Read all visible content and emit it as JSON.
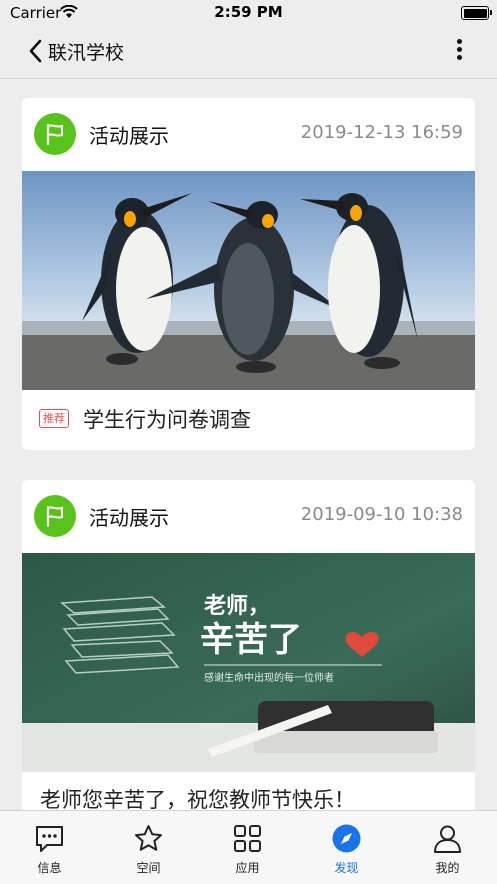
{
  "status_bar": {
    "carrier": "Carrier",
    "time": "2:59 PM"
  },
  "header": {
    "title": "联汛学校"
  },
  "cards": [
    {
      "category": "活动展示",
      "datetime": "2019-12-13 16:59",
      "tag": "推荐",
      "title": "学生行为问卷调查"
    },
    {
      "category": "活动展示",
      "datetime": "2019-09-10 10:38",
      "title": "老师您辛苦了，祝您教师节快乐！",
      "image_text": {
        "line1": "老师，",
        "line2": "辛苦了",
        "line3": "感谢生命中出现的每一位师者"
      }
    }
  ],
  "tabs": [
    {
      "label": "信息",
      "icon": "message-icon"
    },
    {
      "label": "空间",
      "icon": "star-icon"
    },
    {
      "label": "应用",
      "icon": "grid-icon"
    },
    {
      "label": "发现",
      "icon": "compass-icon",
      "active": true
    },
    {
      "label": "我的",
      "icon": "user-icon"
    }
  ],
  "colors": {
    "flag_green": "#59c31b",
    "tab_active": "#1a73e8",
    "tag_red": "#e05050"
  }
}
